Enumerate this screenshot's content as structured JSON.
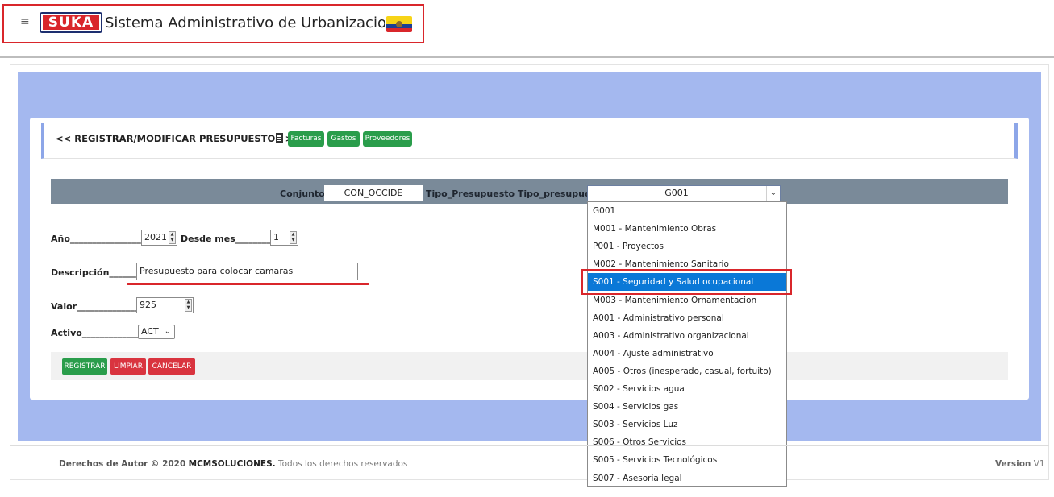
{
  "header": {
    "logo_text": "SUKA",
    "app_title": "Sistema Administrativo de Urbanizaciones",
    "menu_icon": "hamburger-icon",
    "flag_icon": "ecuador-flag-icon"
  },
  "title_bar": {
    "title": "<< REGISTRAR/MODIFICAR PRESUPUESTOS >>",
    "icon": "building-icon",
    "buttons": [
      "Facturas",
      "Gastos",
      "Proveedores"
    ]
  },
  "filter": {
    "conjunto_label": "Conjunto:",
    "conjunto_value": "CON_OCCIDE",
    "tipo_label": "Tipo_Presupuesto Tipo_presupuesto_:",
    "tipo_value": "G001"
  },
  "dropdown": {
    "selected_index": 4,
    "options": [
      "G001",
      "M001 - Mantenimiento Obras",
      "P001 - Proyectos",
      "M002 - Mantenimiento Sanitario",
      "S001 - Seguridad y Salud ocupacional",
      "M003 - Mantenimiento Ornamentacion",
      "A001 - Administrativo personal",
      "A003 - Administrativo organizacional",
      "A004 - Ajuste administrativo",
      "A005 - Otros (inesperado, casual, fortuito)",
      "S002 - Servicios agua",
      "S004 - Servicios gas",
      "S003 - Servicios Luz",
      "S006 - Otros Servicios",
      "S005 - Servicios Tecnológicos",
      "S007 - Asesoria legal"
    ]
  },
  "form": {
    "anio_label": "Año________________:",
    "anio_value": "2021",
    "desde_mes_label": "Desde mes__________:",
    "desde_mes_value": "1",
    "descripcion_label": "Descripción_______:",
    "descripcion_value": "Presupuesto para colocar camaras",
    "valor_label": "Valor______________:",
    "valor_value": "925",
    "activo_label": "Activo_____________:",
    "activo_value": "ACT"
  },
  "actions": {
    "registrar": "REGISTRAR",
    "limpiar": "LIMPIAR",
    "cancelar": "CANCELAR"
  },
  "footer": {
    "copyright_prefix": "Derechos de Autor © 2020",
    "company": "MCMSOLUCIONES.",
    "rights": "Todos los derechos reservados",
    "version_label": "Version",
    "version_value": "V1"
  },
  "colors": {
    "accent_red": "#d9262b",
    "band_blue": "#a4b8ef",
    "success_green": "#2a9d4b",
    "filter_gray": "#7a8a99",
    "selection_blue": "#0a78d7"
  }
}
